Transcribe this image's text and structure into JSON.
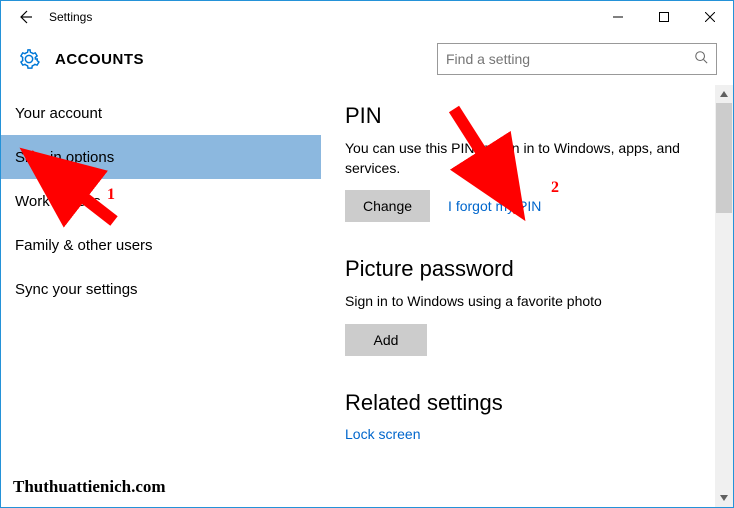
{
  "titlebar": {
    "title": "Settings"
  },
  "header": {
    "category": "ACCOUNTS",
    "search_placeholder": "Find a setting"
  },
  "sidebar": {
    "items": [
      {
        "label": "Your account"
      },
      {
        "label": "Sign-in options"
      },
      {
        "label": "Work access"
      },
      {
        "label": "Family & other users"
      },
      {
        "label": "Sync your settings"
      }
    ],
    "selected_index": 1
  },
  "content": {
    "pin": {
      "heading": "PIN",
      "desc": "You can use this PIN to sign in to Windows, apps, and services.",
      "change_label": "Change",
      "forgot_label": "I forgot my PIN"
    },
    "picture": {
      "heading": "Picture password",
      "desc": "Sign in to Windows using a favorite photo",
      "add_label": "Add"
    },
    "related": {
      "heading": "Related settings",
      "lock_label": "Lock screen"
    }
  },
  "annotations": {
    "label1": "1",
    "label2": "2"
  },
  "watermark": "Thuthuattienich.com"
}
